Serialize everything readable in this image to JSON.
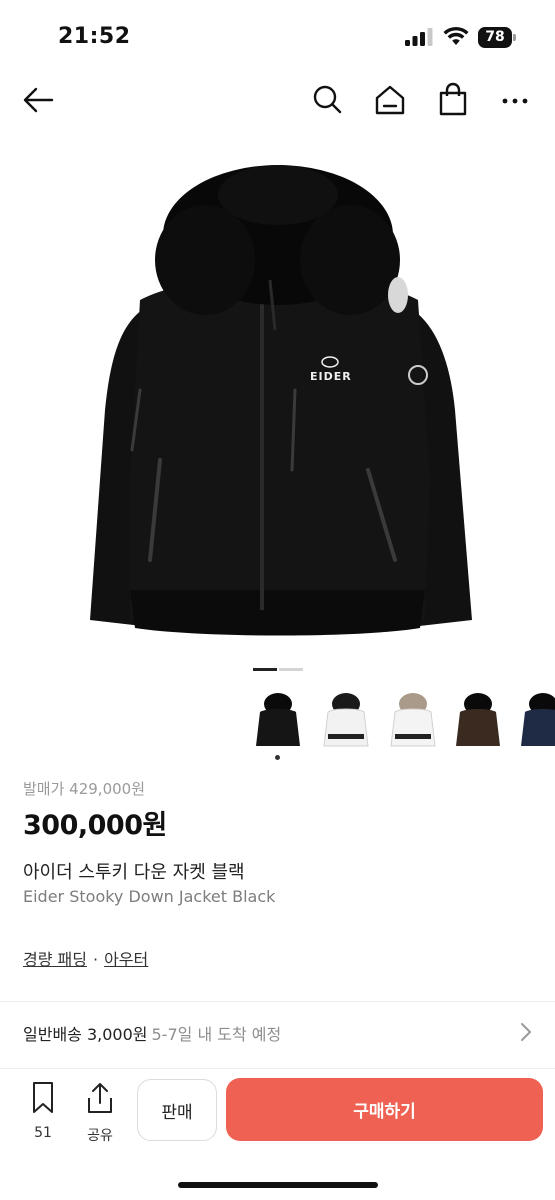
{
  "status_bar": {
    "time": "21:52",
    "battery": "78"
  },
  "nav": {
    "icons": [
      "back-arrow-icon",
      "search-icon",
      "home-icon",
      "shopping-bag-icon",
      "more-icon"
    ]
  },
  "gallery": {
    "main_image": "black EIDER down jacket with fur hood",
    "logo_text": "EIDER",
    "thumbnails": [
      "black",
      "white",
      "white-fur",
      "brown",
      "navy"
    ],
    "selected_thumbnail": 0
  },
  "product": {
    "original_price": "발매가 429,000원",
    "price": "300,000원",
    "name_ko": "아이더 스투키 다운 자켓 블랙",
    "name_en": "Eider Stooky Down Jacket Black",
    "categories": [
      "경량 패딩",
      "아우터"
    ],
    "category_separator": "·"
  },
  "shipping": {
    "label": "일반배송 3,000원",
    "eta": "5-7일 내 도착 예정"
  },
  "bottom_bar": {
    "bookmark_count": "51",
    "share_label": "공유",
    "sell_label": "판매",
    "buy_label": "구매하기"
  },
  "colors": {
    "accent": "#ef6253",
    "text": "#222222",
    "muted": "#8e8e8e"
  }
}
